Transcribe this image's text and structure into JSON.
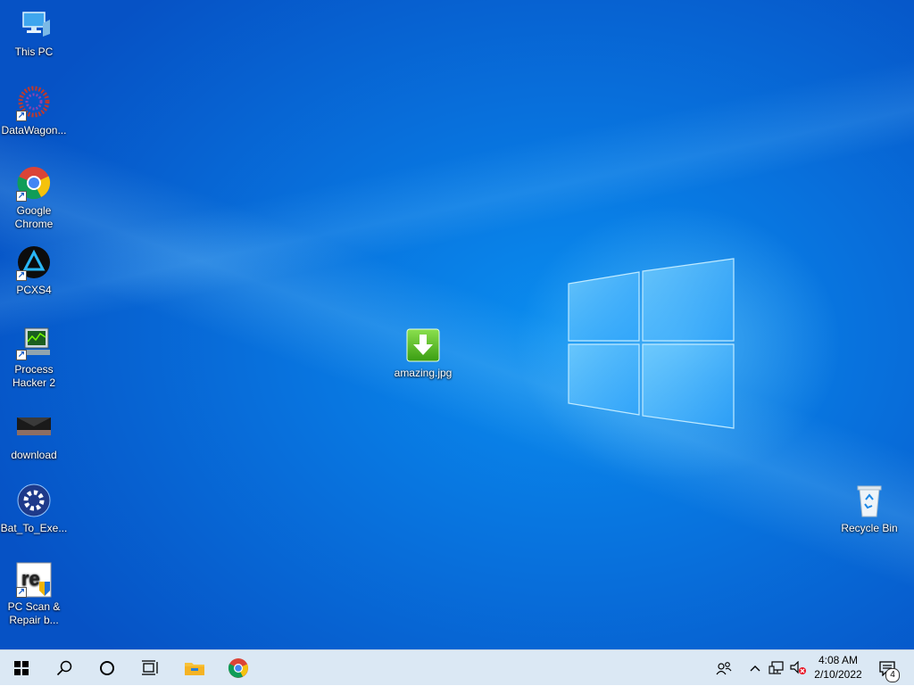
{
  "desktop": {
    "icons": {
      "this_pc": "This PC",
      "datawagon": "DataWagon...",
      "chrome_line1": "Google",
      "chrome_line2": "Chrome",
      "pcxs4": "PCXS4",
      "process_hacker_line1": "Process",
      "process_hacker_line2": "Hacker 2",
      "download": "download",
      "bat_to_exe": "Bat_To_Exe...",
      "pc_scan_line1": "PC Scan &",
      "pc_scan_line2": "Repair b...",
      "amazing": "amazing.jpg",
      "recycle_bin": "Recycle Bin"
    }
  },
  "taskbar": {
    "time": "4:08 AM",
    "date": "2/10/2022",
    "notification_count": "4",
    "accent_color": "#0873de"
  }
}
